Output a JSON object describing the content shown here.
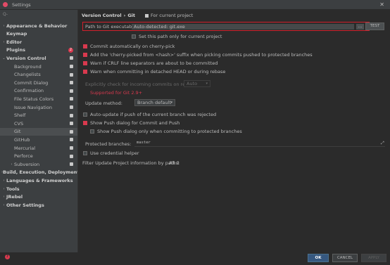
{
  "window": {
    "title": "Settings"
  },
  "sidebar": {
    "search_placeholder": "Q-",
    "items": [
      {
        "label": "Appearance & Behavior",
        "arrow": "›",
        "bold": true
      },
      {
        "label": "Keymap",
        "bold": true
      },
      {
        "label": "Editor",
        "arrow": "›",
        "bold": true
      },
      {
        "label": "Plugins",
        "bold": true,
        "badge": "2"
      },
      {
        "label": "Version Control",
        "arrow": "⌄",
        "bold": true,
        "doc": true
      },
      {
        "label": "Background",
        "doc": true
      },
      {
        "label": "Changelists",
        "doc": true
      },
      {
        "label": "Commit Dialog",
        "doc": true
      },
      {
        "label": "Confirmation",
        "doc": true
      },
      {
        "label": "File Status Colors",
        "doc": true
      },
      {
        "label": "Issue Navigation",
        "doc": true
      },
      {
        "label": "Shelf",
        "doc": true
      },
      {
        "label": "CVS",
        "doc": true
      },
      {
        "label": "Git",
        "doc": true,
        "selected": true
      },
      {
        "label": "GitHub",
        "doc": true
      },
      {
        "label": "Mercurial",
        "doc": true
      },
      {
        "label": "Perforce",
        "doc": true
      },
      {
        "label": "Subversion",
        "arrow": "›",
        "doc": true
      },
      {
        "label": "Build, Execution, Deployment",
        "arrow": "›",
        "bold": true
      },
      {
        "label": "Languages & Frameworks",
        "arrow": "›",
        "bold": true
      },
      {
        "label": "Tools",
        "arrow": "›",
        "bold": true
      },
      {
        "label": "JRebel",
        "arrow": "›",
        "bold": true
      },
      {
        "label": "Other Settings",
        "arrow": "›",
        "bold": true
      }
    ]
  },
  "header": {
    "crumb_parent": "Version Control",
    "crumb_sep": "›",
    "crumb_current": "Git",
    "project_scope": "For current project"
  },
  "git": {
    "path_label": "Path to Git executable:",
    "path_value": "Auto-detected: git.exe",
    "browse_label": "...",
    "test_label": "TEST",
    "set_path_only": "Set this path only for current project",
    "commit_cherry_pick": "Commit automatically on cherry-pick",
    "cherry_picked_suffix": "Add the 'cherry-picked from <hash>' suffix when picking commits pushed to protected branches",
    "warn_crlf": "Warn if CRLF line separators are about to be committed",
    "warn_detached": "Warn when committing in detached HEAD or during rebase",
    "explicit_check_label": "Explicitly check for incoming commits on remotes:",
    "explicit_check_value": "Auto",
    "supported_note": "Supported for Git 2.9+",
    "update_method_label": "Update method:",
    "update_method_value": "Branch default",
    "auto_update": "Auto-update if push of the current branch was rejected",
    "show_push_dialog": "Show Push dialog for Commit and Push",
    "show_push_protected": "Show Push dialog only when committing to protected branches",
    "protected_label": "Protected branches:",
    "protected_value": "master",
    "credential_helper": "Use credential helper",
    "filter_label": "Filter Update Project information by paths:",
    "filter_value": "All"
  },
  "footer": {
    "ok": "OK",
    "cancel": "CANCEL",
    "apply": "APPLY"
  },
  "colors": {
    "accent": "#d9394e",
    "highlight_border": "#d11f2b",
    "ok_button": "#365880"
  }
}
